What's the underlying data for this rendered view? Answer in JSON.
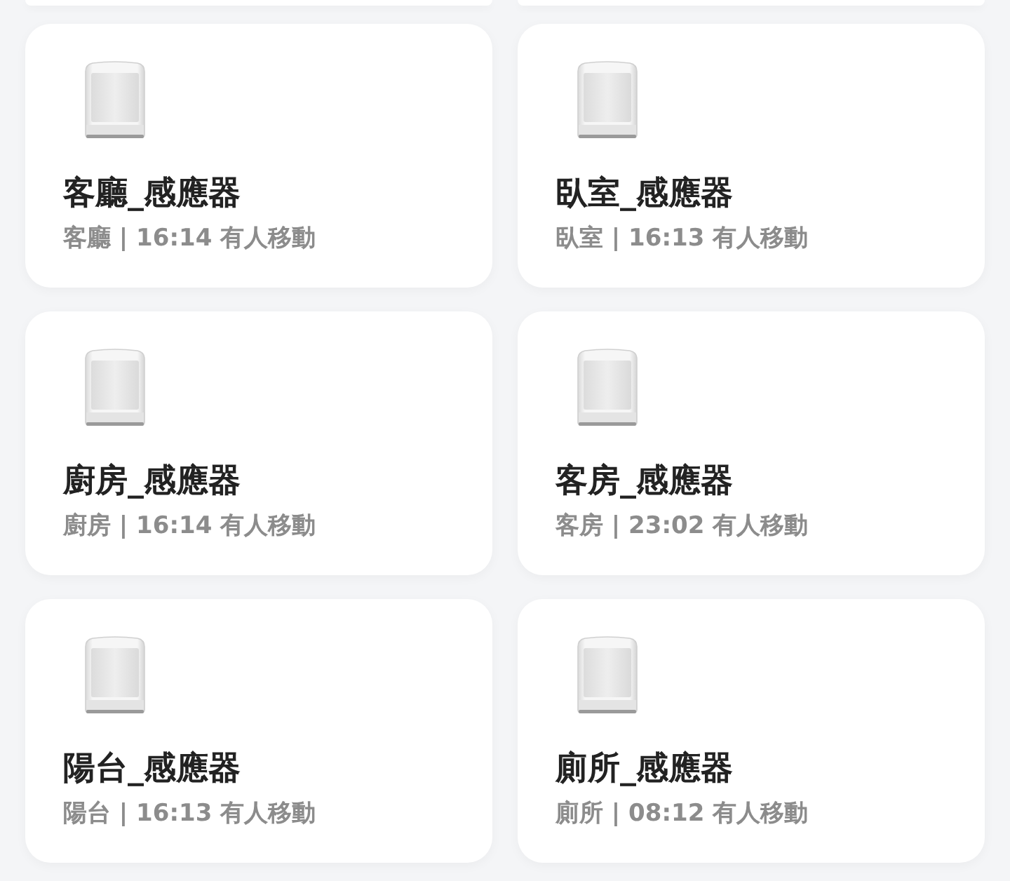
{
  "row_above_cut_off": true,
  "devices": [
    {
      "name": "客廳_感應器",
      "status": "客廳 | 16:14 有人移動"
    },
    {
      "name": "臥室_感應器",
      "status": "臥室 | 16:13 有人移動"
    },
    {
      "name": "廚房_感應器",
      "status": "廚房 | 16:14 有人移動"
    },
    {
      "name": "客房_感應器",
      "status": "客房 | 23:02 有人移動"
    },
    {
      "name": "陽台_感應器",
      "status": "陽台 | 16:13 有人移動"
    },
    {
      "name": "廁所_感應器",
      "status": "廁所 | 08:12 有人移動"
    }
  ]
}
